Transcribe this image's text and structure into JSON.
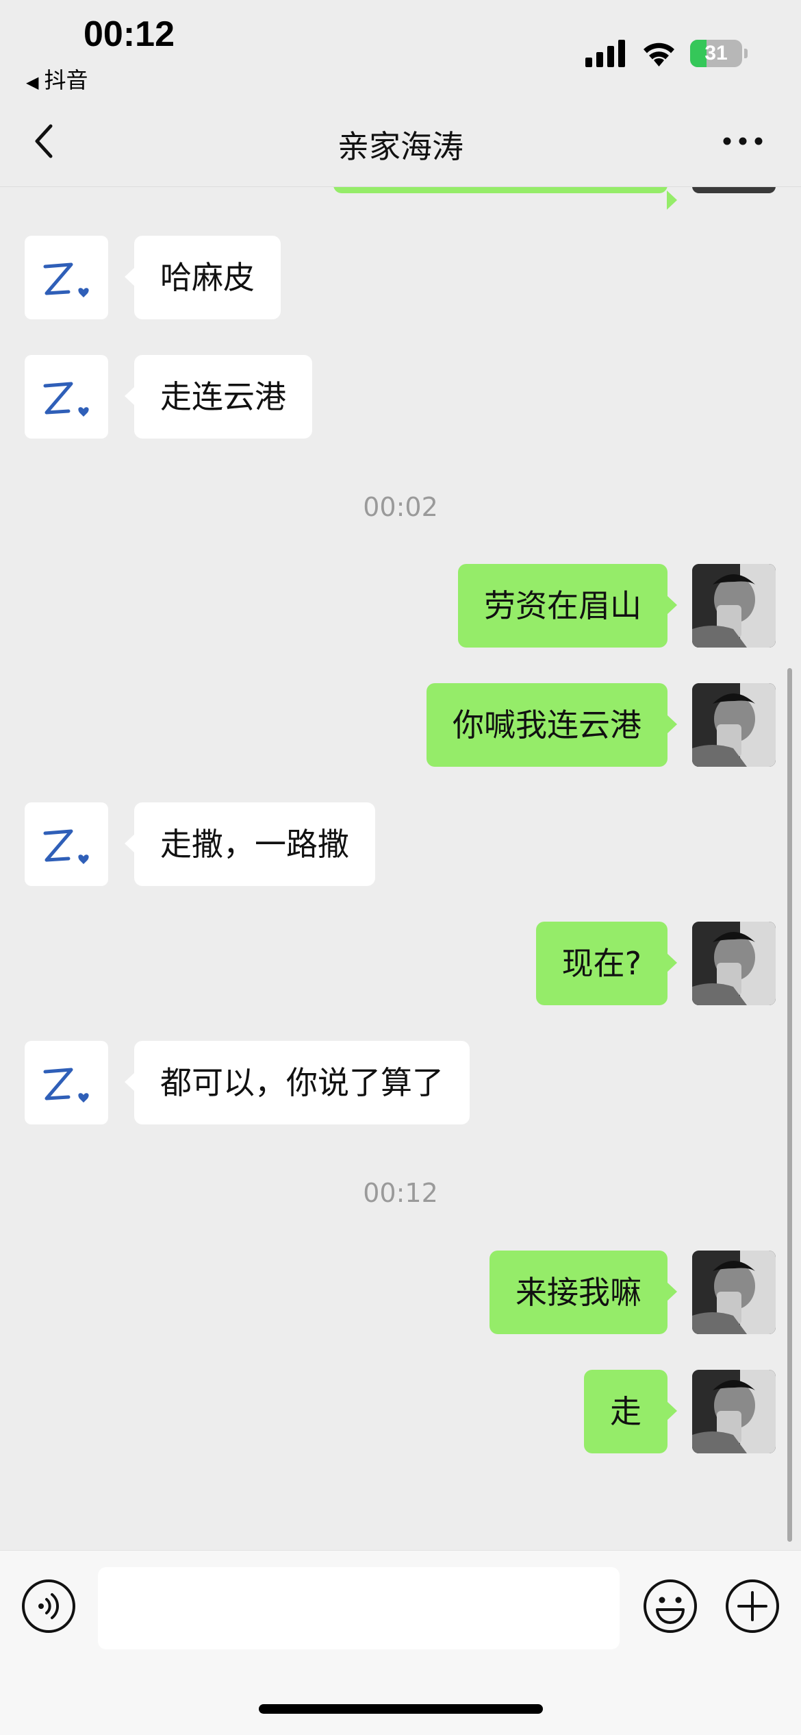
{
  "status_bar": {
    "time": "00:12",
    "back_app": "抖音",
    "battery_level": "31",
    "battery_fraction": 0.31
  },
  "nav": {
    "title": "亲家海涛"
  },
  "messages": [
    {
      "side": "in",
      "text": "哈麻皮"
    },
    {
      "side": "in",
      "text": "走连云港"
    },
    {
      "side": "time",
      "text": "00:02"
    },
    {
      "side": "out",
      "text": "劳资在眉山"
    },
    {
      "side": "out",
      "text": "你喊我连云港"
    },
    {
      "side": "in",
      "text": "走撒，一路撒"
    },
    {
      "side": "out",
      "text": "现在?"
    },
    {
      "side": "in",
      "text": "都可以，你说了算了"
    },
    {
      "side": "time",
      "text": "00:12"
    },
    {
      "side": "out",
      "text": "来接我嘛"
    },
    {
      "side": "out",
      "text": "走"
    }
  ],
  "input": {
    "placeholder": "",
    "value": ""
  },
  "colors": {
    "background": "#ededed",
    "outgoing_bubble": "#95ec69",
    "incoming_bubble": "#ffffff",
    "contact_avatar_mark": "#2f5fb8"
  },
  "icons": {
    "back": "chevron-left-icon",
    "more": "more-dots-icon",
    "voice": "voice-icon",
    "emoji": "emoji-icon",
    "plus": "plus-icon"
  }
}
